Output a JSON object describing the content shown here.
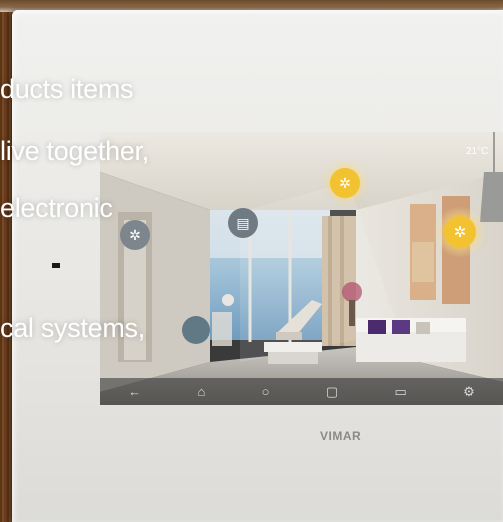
{
  "overlay_lines": [
    "ducts items",
    "live together,",
    "electronic",
    "cal systems,"
  ],
  "screen": {
    "clock": "21°C",
    "room_controls": [
      {
        "name": "ceiling-light",
        "icon": "bulb-icon",
        "state": "on"
      },
      {
        "name": "wall-light-left",
        "icon": "bulb-icon",
        "state": "off"
      },
      {
        "name": "tv-light",
        "icon": "bulb-icon",
        "state": "off"
      },
      {
        "name": "right-lamp",
        "icon": "bulb-icon",
        "state": "on"
      },
      {
        "name": "blinds",
        "icon": "blinds-icon",
        "state": "off"
      }
    ],
    "nav_icons": [
      "back-icon",
      "home-icon",
      "circle-home-icon",
      "recent-apps-icon",
      "window-icon",
      "settings-icon"
    ]
  },
  "brand": "VIMAR",
  "colors": {
    "active": "#f2c230",
    "inactive": "#8a9196",
    "text_overlay": "#ffffff"
  }
}
